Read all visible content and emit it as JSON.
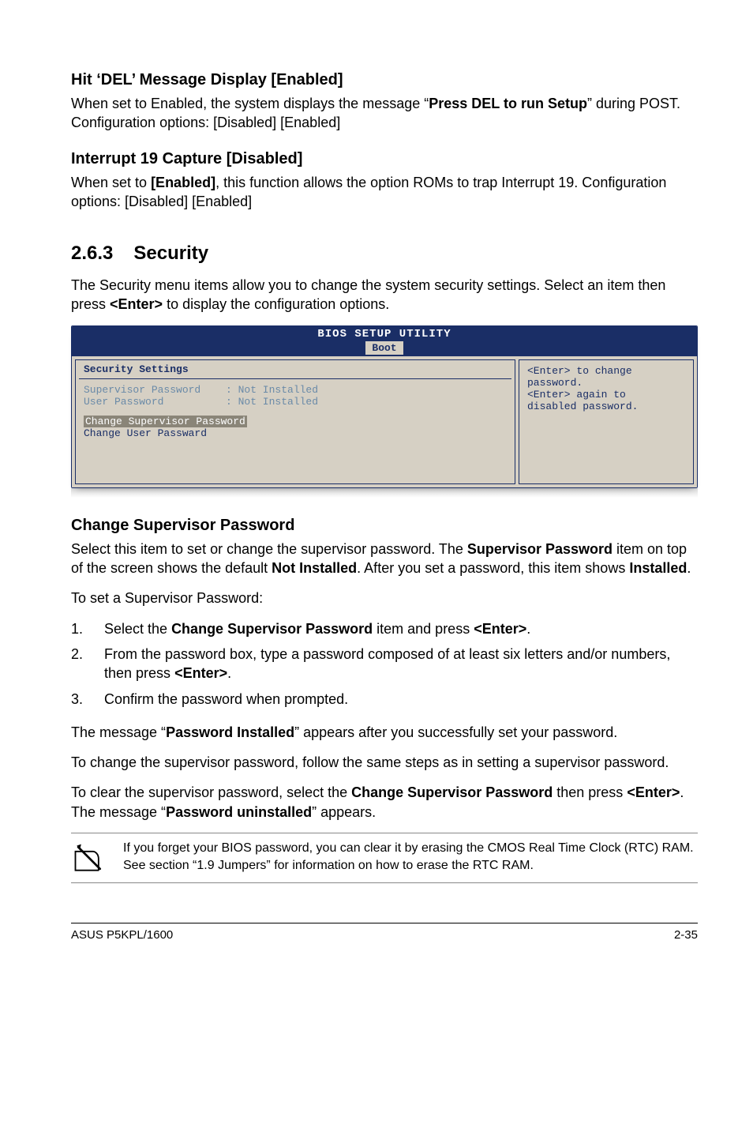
{
  "section1": {
    "heading": "Hit ‘DEL’ Message Display [Enabled]",
    "body_pre": "When set to Enabled, the system displays the message “",
    "body_bold": "Press DEL to run Setup",
    "body_post": "” during POST. Configuration options: [Disabled] [Enabled]"
  },
  "section2": {
    "heading": "Interrupt 19 Capture [Disabled]",
    "body_pre": "When set to ",
    "body_bold": "[Enabled]",
    "body_post": ", this function allows the option ROMs to trap Interrupt 19. Configuration options: [Disabled] [Enabled]"
  },
  "section3": {
    "number": "2.6.3",
    "title": "Security",
    "intro_pre": "The Security menu items allow you to change the system security settings. Select an item then press ",
    "intro_bold": "<Enter>",
    "intro_post": " to display the configuration options."
  },
  "bios": {
    "title": "BIOS SETUP UTILITY",
    "tab": "Boot",
    "left_heading": "Security Settings",
    "row1_k": "Supervisor Password",
    "row1_v": ": Not Installed",
    "row2_k": "User Password",
    "row2_v": ": Not Installed",
    "sel": "Change Supervisor Password",
    "link": "Change User Passward",
    "help1": "<Enter> to change",
    "help2": "password.",
    "help3": "<Enter> again to",
    "help4": "disabled password."
  },
  "section4": {
    "heading": "Change Supervisor Password",
    "p1_pre": "Select this item to set or change the supervisor password. The ",
    "p1_b1": "Supervisor Password",
    "p1_mid": " item on top of the screen shows the default ",
    "p1_b2": "Not Installed",
    "p1_mid2": ". After you set a password, this item shows ",
    "p1_b3": "Installed",
    "p1_post": ".",
    "p2": "To set a Supervisor Password:",
    "step1_pre": "Select the ",
    "step1_b1": "Change Supervisor Password",
    "step1_mid": " item and press ",
    "step1_b2": "<Enter>",
    "step1_post": ".",
    "step2_pre": "From the password box, type a password composed of at least six letters and/or numbers, then press ",
    "step2_b": "<Enter>",
    "step2_post": ".",
    "step3": "Confirm the password when prompted.",
    "p3_pre": "The message “",
    "p3_b": "Password Installed",
    "p3_post": "” appears after you successfully set your password.",
    "p4": "To change the supervisor password, follow the same steps as in setting a supervisor password.",
    "p5_pre": "To clear the supervisor password, select the ",
    "p5_b1": "Change Supervisor Password",
    "p5_mid": " then press ",
    "p5_b2": "<Enter>",
    "p5_mid2": ". The message “",
    "p5_b3": "Password uninstalled",
    "p5_post": "” appears."
  },
  "note": {
    "text": "If you forget your BIOS password, you can clear it by erasing the CMOS Real Time Clock (RTC) RAM. See section “1.9 Jumpers” for information on how to erase the RTC RAM."
  },
  "footer": {
    "left": "ASUS P5KPL/1600",
    "right": "2-35"
  }
}
